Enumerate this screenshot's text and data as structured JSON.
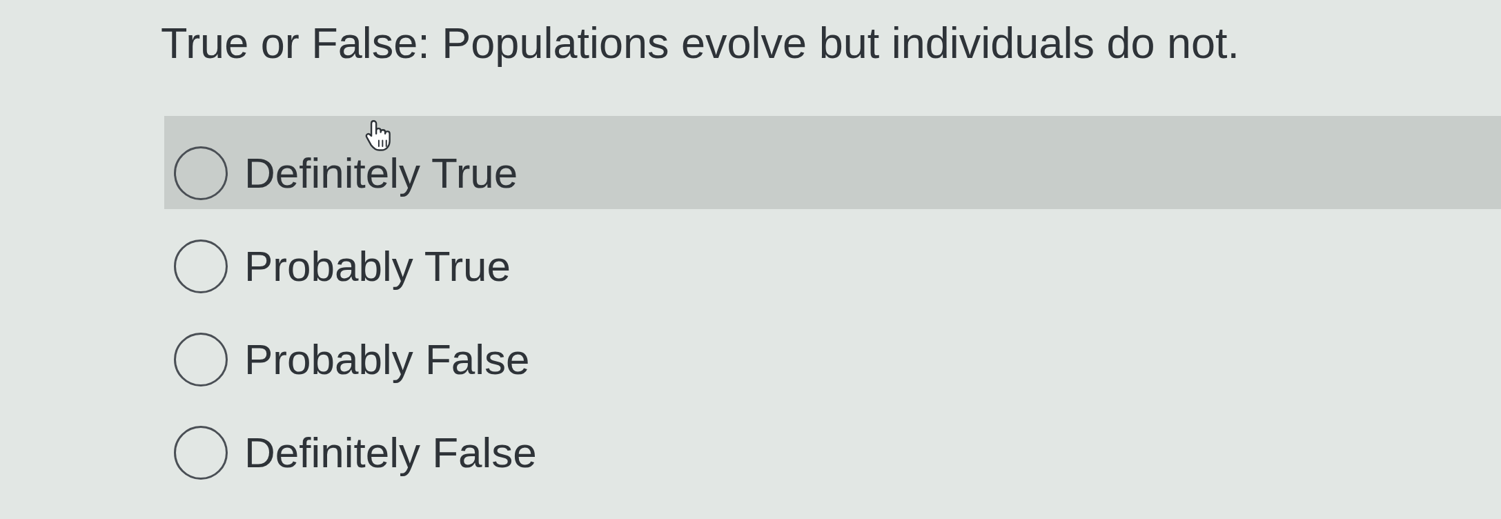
{
  "question": "True or False: Populations evolve but individuals do not.",
  "options": [
    {
      "label": "Definitely True",
      "selected": false,
      "hovered": true
    },
    {
      "label": "Probably True",
      "selected": false,
      "hovered": false
    },
    {
      "label": "Probably False",
      "selected": false,
      "hovered": false
    },
    {
      "label": "Definitely False",
      "selected": false,
      "hovered": false
    }
  ]
}
